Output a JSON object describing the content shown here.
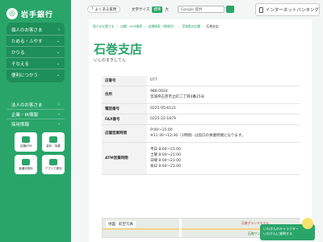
{
  "sidebar": {
    "logo_text": "岩手銀行",
    "main_nav": [
      {
        "label": "個人のお客さま"
      },
      {
        "label": "ためる・ふやす"
      },
      {
        "label": "かりる"
      },
      {
        "label": "そなえる"
      },
      {
        "label": "便利につかう"
      }
    ],
    "sub_nav": [
      {
        "label": "法人のお客さま"
      },
      {
        "label": "企業・IR情報"
      },
      {
        "label": "採用情報"
      }
    ],
    "tiles": [
      {
        "label": "店舗ATM"
      },
      {
        "label": "金利・為替"
      },
      {
        "label": "各種手数料"
      },
      {
        "label": "アプリで便利"
      }
    ]
  },
  "topbar": {
    "faq_label": "よくある質問",
    "fontsize_label": "文字サイズ",
    "fontsize_std": "標準",
    "fontsize_large": "大",
    "search_placeholder": "Google 提供",
    "ib_label": "インターネットバンキング"
  },
  "breadcrumb": [
    "個人のお客さま",
    "店舗・ATM検索",
    "店舗検索（地域別）",
    "宮城県の店舗",
    "石巻支店"
  ],
  "branch": {
    "title": "石巻支店",
    "kana": "いしのまきしてん"
  },
  "info": {
    "rows": [
      {
        "key": "店番号",
        "value": "077",
        "value2": ""
      },
      {
        "key": "住所",
        "value": "986-0024",
        "value2": "宮城県石巻市立町二丁目4番25号"
      },
      {
        "key": "電話番号",
        "value": "0225-95-6121",
        "value2": ""
      },
      {
        "key": "FAX番号",
        "value": "0225-22-1879",
        "value2": ""
      },
      {
        "key": "店舗営業時間",
        "value": "9:00～15:00",
        "value2": "※11:30～12:30（1時間）は窓口の休業時間となります。"
      },
      {
        "key": "ATM営業時間",
        "value": "平日 8:00～21:00",
        "value2": "土曜 8:00～21:00",
        "value3": "日曜 8:00～21:00",
        "value4": "祝日 8:00～21:00"
      }
    ]
  },
  "map": {
    "tab_map": "地図",
    "tab_sat": "航空写真",
    "labels": [
      "石巻グランドホテル",
      "石巻サンプラザ"
    ]
  },
  "banner": {
    "line1": "いわぎんのキャラクター",
    "line2": "いわぎんに質問する"
  }
}
